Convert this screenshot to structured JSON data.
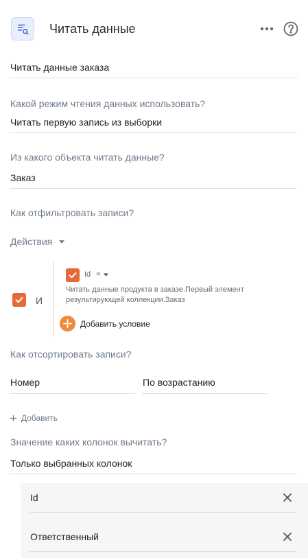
{
  "header": {
    "title": "Читать данные",
    "icon": "search-list-icon",
    "more_icon": "more-dots-icon",
    "help_icon": "help-circle-icon"
  },
  "element_name": "Читать данные заказа",
  "read_mode": {
    "label": "Какой режим чтения данных использовать?",
    "value": "Читать первую запись из выборки"
  },
  "object": {
    "label": "Из какого объекта читать данные?",
    "value": "Заказ"
  },
  "filter": {
    "label": "Как отфильтровать записи?",
    "actions_label": "Действия",
    "group_operator": "И",
    "condition": {
      "field": "Id",
      "operator": "=",
      "value": "Читать данные продукта в заказе.Первый элемент результирующей коллекции.Заказ"
    },
    "add_condition_label": "Добавить условие"
  },
  "sort": {
    "label": "Как отсортировать записи?",
    "column": "Номер",
    "direction": "По возрастанию",
    "add_label": "Добавить"
  },
  "columns": {
    "label": "Значение каких колонок вычитать?",
    "mode": "Только выбранных колонок",
    "items": [
      "Id",
      "Ответственный"
    ]
  },
  "colors": {
    "accent": "#e56a35",
    "label": "#6e7b8a"
  }
}
